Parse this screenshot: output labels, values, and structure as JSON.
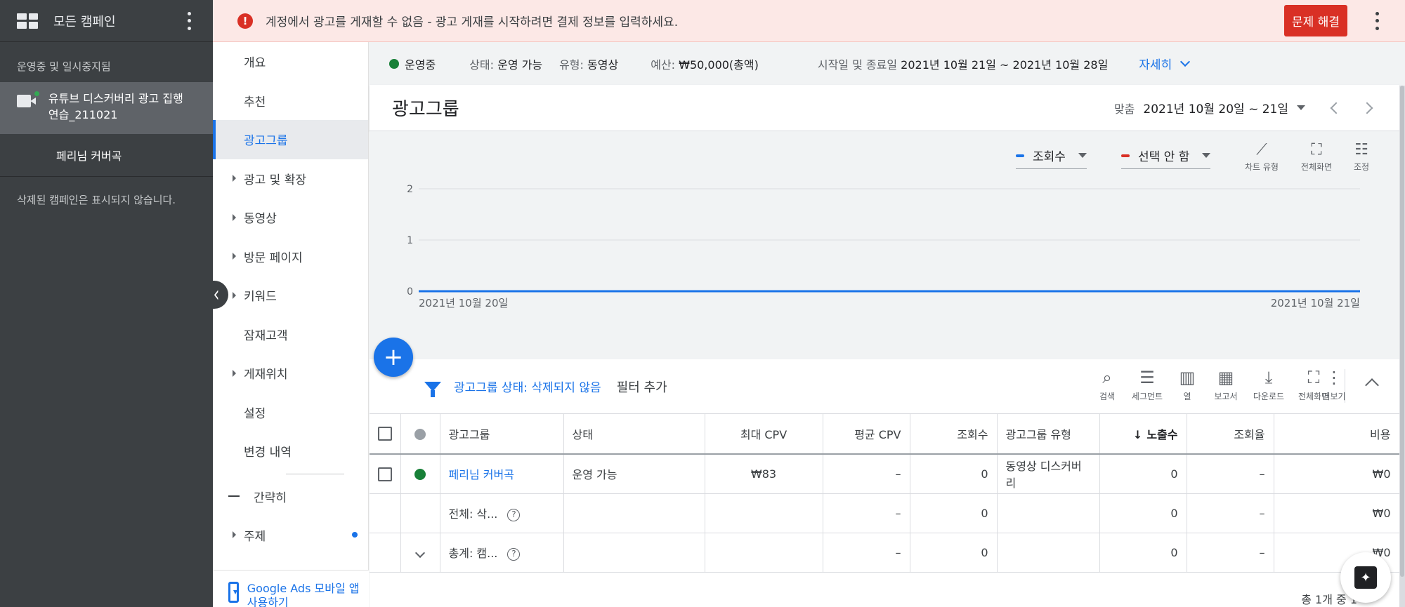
{
  "left_panel": {
    "title": "모든 캠페인",
    "section_label": "운영중 및 일시중지됨",
    "campaign_name": "유튜브 디스커버리 광고 집행 연습_211021",
    "adgroup_name": "페리님 커버곡",
    "deleted_note": "삭제된 캠페인은 표시되지 않습니다."
  },
  "alert": {
    "message": "계정에서 광고를 게재할 수 없음 - 광고 게재를 시작하려면 결제 정보를 입력하세요.",
    "fix_label": "문제 해결",
    "color": "#d93025"
  },
  "nav": {
    "items": [
      {
        "label": "개요",
        "expandable": false
      },
      {
        "label": "추천",
        "expandable": false
      },
      {
        "label": "광고그룹",
        "expandable": false
      },
      {
        "label": "광고 및 확장",
        "expandable": true
      },
      {
        "label": "동영상",
        "expandable": true
      },
      {
        "label": "방문 페이지",
        "expandable": true
      },
      {
        "label": "키워드",
        "expandable": true
      },
      {
        "label": "잠재고객",
        "expandable": false
      },
      {
        "label": "게재위치",
        "expandable": true
      },
      {
        "label": "설정",
        "expandable": false
      },
      {
        "label": "변경 내역",
        "expandable": false
      }
    ],
    "collapse_label": "간략히",
    "topic_label": "주제",
    "mobile_label": "Google Ads 모바일 앱 사용하기"
  },
  "summary": {
    "status": "운영중",
    "state_label": "상태:",
    "state_value": "운영 가능",
    "type_label": "유형:",
    "type_value": "동영상",
    "budget_label": "예산:",
    "budget_value": "₩50,000(총액)",
    "dates_label": "시작일 및 종료일",
    "dates_value": "2021년 10월 21일 ~ 2021년 10월 28일",
    "detail_label": "자세히"
  },
  "header": {
    "title": "광고그룹",
    "date_label": "맞춤",
    "date_value": "2021년 10월 20일 ~ 21일"
  },
  "chart_toolbar": {
    "metric1": "조회수",
    "metric1_color": "#1a73e8",
    "metric2": "선택 안 함",
    "metric2_color": "#d93025",
    "chart_type_label": "차트 유형",
    "fullscreen_label": "전체화면",
    "adjust_label": "조정"
  },
  "chart_data": {
    "type": "line",
    "x": [
      "2021년 10월 20일",
      "2021년 10월 21일"
    ],
    "series": [
      {
        "name": "조회수",
        "values": [
          0,
          0
        ]
      }
    ],
    "yticks": [
      0,
      1,
      2
    ],
    "ylim": [
      0,
      2
    ],
    "grid": true
  },
  "filter": {
    "label": "광고그룹 상태:",
    "value": "삭제되지 않음",
    "add_label": "필터 추가"
  },
  "table_toolbar": {
    "search": "검색",
    "segment": "세그먼트",
    "columns": "열",
    "report": "보고서",
    "download": "다운로드",
    "fullscreen": "전체화면",
    "more": "더보기"
  },
  "table": {
    "headers": [
      "광고그룹",
      "상태",
      "최대 CPV",
      "평균 CPV",
      "조회수",
      "광고그룹 유형",
      "노출수",
      "조회율",
      "비용"
    ],
    "rows": [
      {
        "name": "페리님 커버곡",
        "status": "운영 가능",
        "max_cpv": "₩83",
        "avg_cpv": "–",
        "views": "0",
        "type": "동영상 디스커버리",
        "impressions": "0",
        "view_rate": "–",
        "cost": "₩0"
      }
    ],
    "total1": {
      "name": "전체: 삭...",
      "avg_cpv": "–",
      "views": "0",
      "impressions": "0",
      "view_rate": "–",
      "cost": "₩0"
    },
    "total2": {
      "name": "총계: 캠...",
      "avg_cpv": "–",
      "views": "0",
      "impressions": "0",
      "view_rate": "–",
      "cost": "₩0"
    },
    "footer": "총 1개 중 1"
  }
}
